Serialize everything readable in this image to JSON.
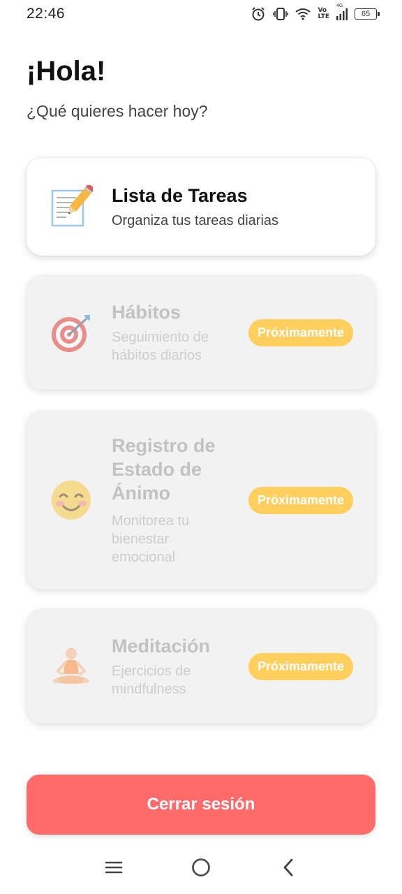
{
  "status_bar": {
    "time": "22:46",
    "network_top": "Vo",
    "network_bottom": "LTE",
    "network_gen": "4G",
    "battery_level": "65",
    "icons": [
      "alarm-icon",
      "vibrate-icon",
      "wifi-icon",
      "signal-icon",
      "battery-icon"
    ]
  },
  "header": {
    "title": "¡Hola!",
    "subtitle": "¿Qué quieres hacer hoy?"
  },
  "cards": [
    {
      "title": "Lista de Tareas",
      "description": "Organiza tus tareas diarias",
      "icon": "memo-icon",
      "enabled": true,
      "badge": ""
    },
    {
      "title": "Hábitos",
      "description": "Seguimiento de hábitos diarios",
      "icon": "target-icon",
      "enabled": false,
      "badge": "Próximamente"
    },
    {
      "title": "Registro de Estado de Ánimo",
      "description": "Monitorea tu bienestar emocional",
      "icon": "smiling-face-icon",
      "enabled": false,
      "badge": "Próximamente"
    },
    {
      "title": "Meditación",
      "description": "Ejercicios de mindfulness",
      "icon": "meditation-icon",
      "enabled": false,
      "badge": "Próximamente"
    }
  ],
  "logout": {
    "label": "Cerrar sesión"
  },
  "nav": {
    "icons": [
      "menu-icon",
      "home-icon",
      "back-icon"
    ]
  },
  "colors": {
    "badge": "#ffcf5e",
    "logout": "#ff6b6b",
    "disabled_card": "#f2f2f2"
  }
}
